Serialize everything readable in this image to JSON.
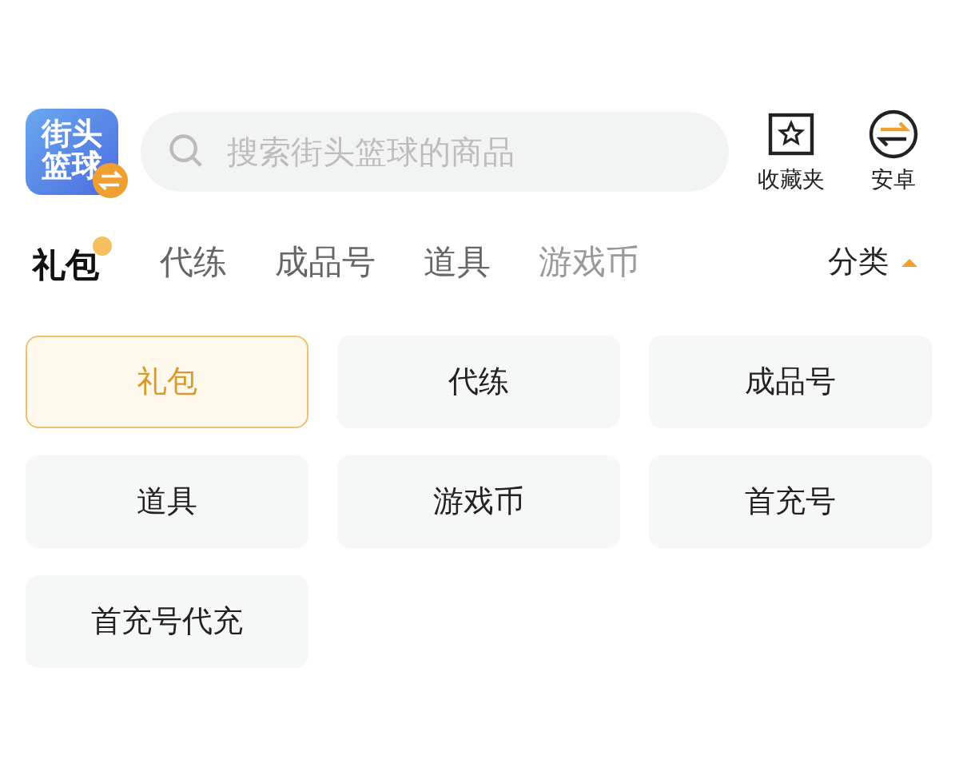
{
  "app_icon": {
    "label": "街头篮球"
  },
  "search": {
    "placeholder": "搜索街头篮球的商品"
  },
  "actions": [
    {
      "label": "收藏夹",
      "kind": "favorites"
    },
    {
      "label": "安卓",
      "kind": "android"
    }
  ],
  "tabs": [
    {
      "label": "礼包",
      "selected": true
    },
    {
      "label": "代练",
      "selected": false
    },
    {
      "label": "成品号",
      "selected": false
    },
    {
      "label": "道具",
      "selected": false
    },
    {
      "label": "游戏币",
      "selected": false
    }
  ],
  "category_toggle": {
    "label": "分类",
    "expanded": true
  },
  "categories": [
    {
      "label": "礼包",
      "selected": true
    },
    {
      "label": "代练",
      "selected": false
    },
    {
      "label": "成品号",
      "selected": false
    },
    {
      "label": "道具",
      "selected": false
    },
    {
      "label": "游戏币",
      "selected": false
    },
    {
      "label": "首充号",
      "selected": false
    },
    {
      "label": "首充号代充",
      "selected": false
    }
  ]
}
